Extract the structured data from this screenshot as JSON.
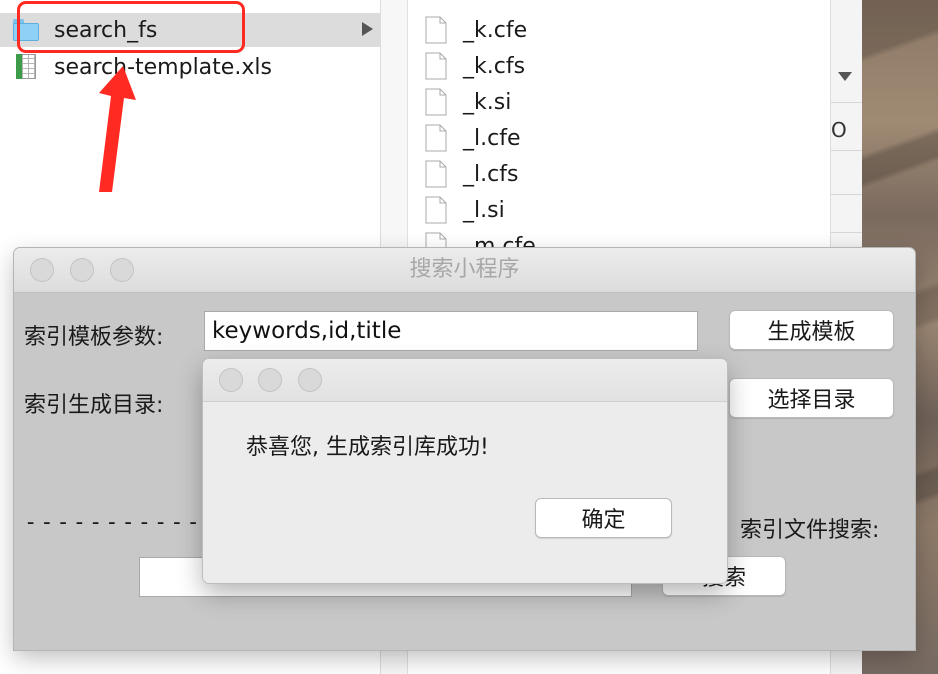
{
  "finder": {
    "column1": [
      {
        "name": "search_fs",
        "kind": "folder-icon",
        "selected": true
      },
      {
        "name": "search-template.xls",
        "kind": "spreadsheet-icon",
        "selected": false
      }
    ],
    "column3": [
      {
        "name": "_k.cfe"
      },
      {
        "name": "_k.cfs"
      },
      {
        "name": "_k.si"
      },
      {
        "name": "_l.cfe"
      },
      {
        "name": "_l.cfs"
      },
      {
        "name": "_l.si"
      },
      {
        "name": "_m.cfe"
      }
    ],
    "column4_text": "O"
  },
  "app": {
    "title": "搜索小程序",
    "index_params_label": "索引模板参数:",
    "index_params_value": "keywords,id,title",
    "generate_template_button": "生成模板",
    "index_dir_label": "索引生成目录:",
    "choose_dir_button": "选择目录",
    "divider_text": "------------",
    "index_search_label": "索引文件搜索:",
    "search_input_value": "",
    "search_button": "搜索"
  },
  "dialog": {
    "message": "恭喜您, 生成索引库成功!",
    "ok_button": "确定"
  },
  "annotation": {
    "color": "#ff2a21"
  }
}
